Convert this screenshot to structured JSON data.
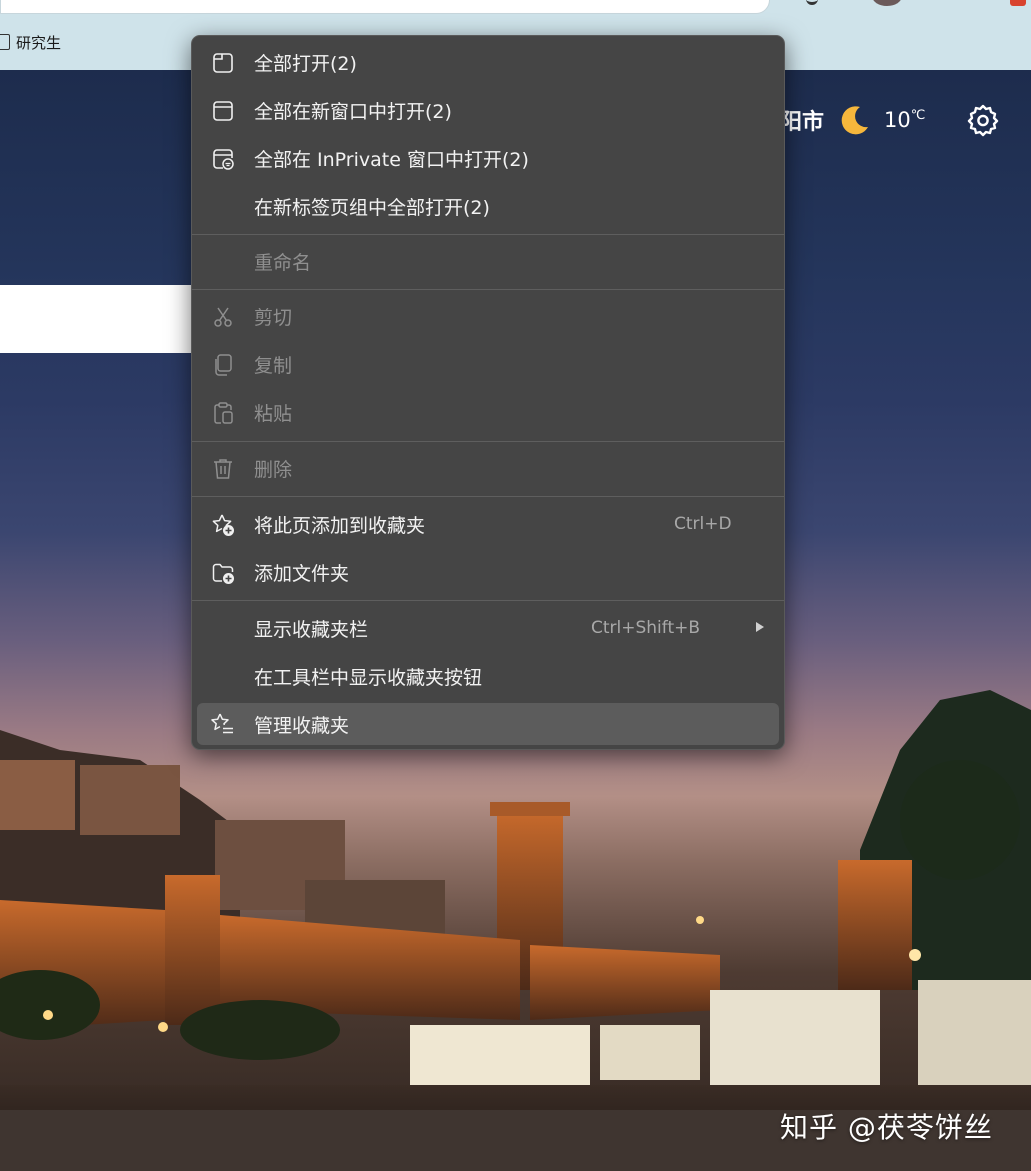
{
  "favorites_bar": {
    "items": [
      {
        "label": "研究生"
      }
    ]
  },
  "weather": {
    "city": "阳市",
    "temperature": "10",
    "unit": "℃",
    "icon": "moon-icon"
  },
  "context_menu": {
    "items": [
      {
        "label": "全部打开(2)",
        "icon": "tab-icon",
        "enabled": true
      },
      {
        "label": "全部在新窗口中打开(2)",
        "icon": "window-icon",
        "enabled": true
      },
      {
        "label": "全部在 InPrivate 窗口中打开(2)",
        "icon": "inprivate-window-icon",
        "enabled": true
      },
      {
        "label": "在新标签页组中全部打开(2)",
        "icon": "",
        "enabled": true
      },
      {
        "label": "重命名",
        "icon": "",
        "enabled": false
      },
      {
        "label": "剪切",
        "icon": "scissors-icon",
        "enabled": false
      },
      {
        "label": "复制",
        "icon": "copy-icon",
        "enabled": false
      },
      {
        "label": "粘贴",
        "icon": "clipboard-icon",
        "enabled": false
      },
      {
        "label": "删除",
        "icon": "trash-icon",
        "enabled": false
      },
      {
        "label": "将此页添加到收藏夹",
        "icon": "star-add-icon",
        "shortcut": "Ctrl+D",
        "enabled": true
      },
      {
        "label": "添加文件夹",
        "icon": "folder-add-icon",
        "enabled": true
      },
      {
        "label": "显示收藏夹栏",
        "icon": "",
        "shortcut": "Ctrl+Shift+B",
        "submenu": true,
        "enabled": true
      },
      {
        "label": "在工具栏中显示收藏夹按钮",
        "icon": "",
        "enabled": true
      },
      {
        "label": "管理收藏夹",
        "icon": "star-list-icon",
        "enabled": true,
        "highlighted": true
      }
    ]
  },
  "watermark": "知乎 @茯苓饼丝",
  "colors": {
    "menu_bg": "#454545",
    "menu_hover": "#5c5c5c",
    "menu_text": "#f2f2f2",
    "menu_disabled": "#8f8f8f",
    "chrome_bg": "#cfe3ea"
  }
}
